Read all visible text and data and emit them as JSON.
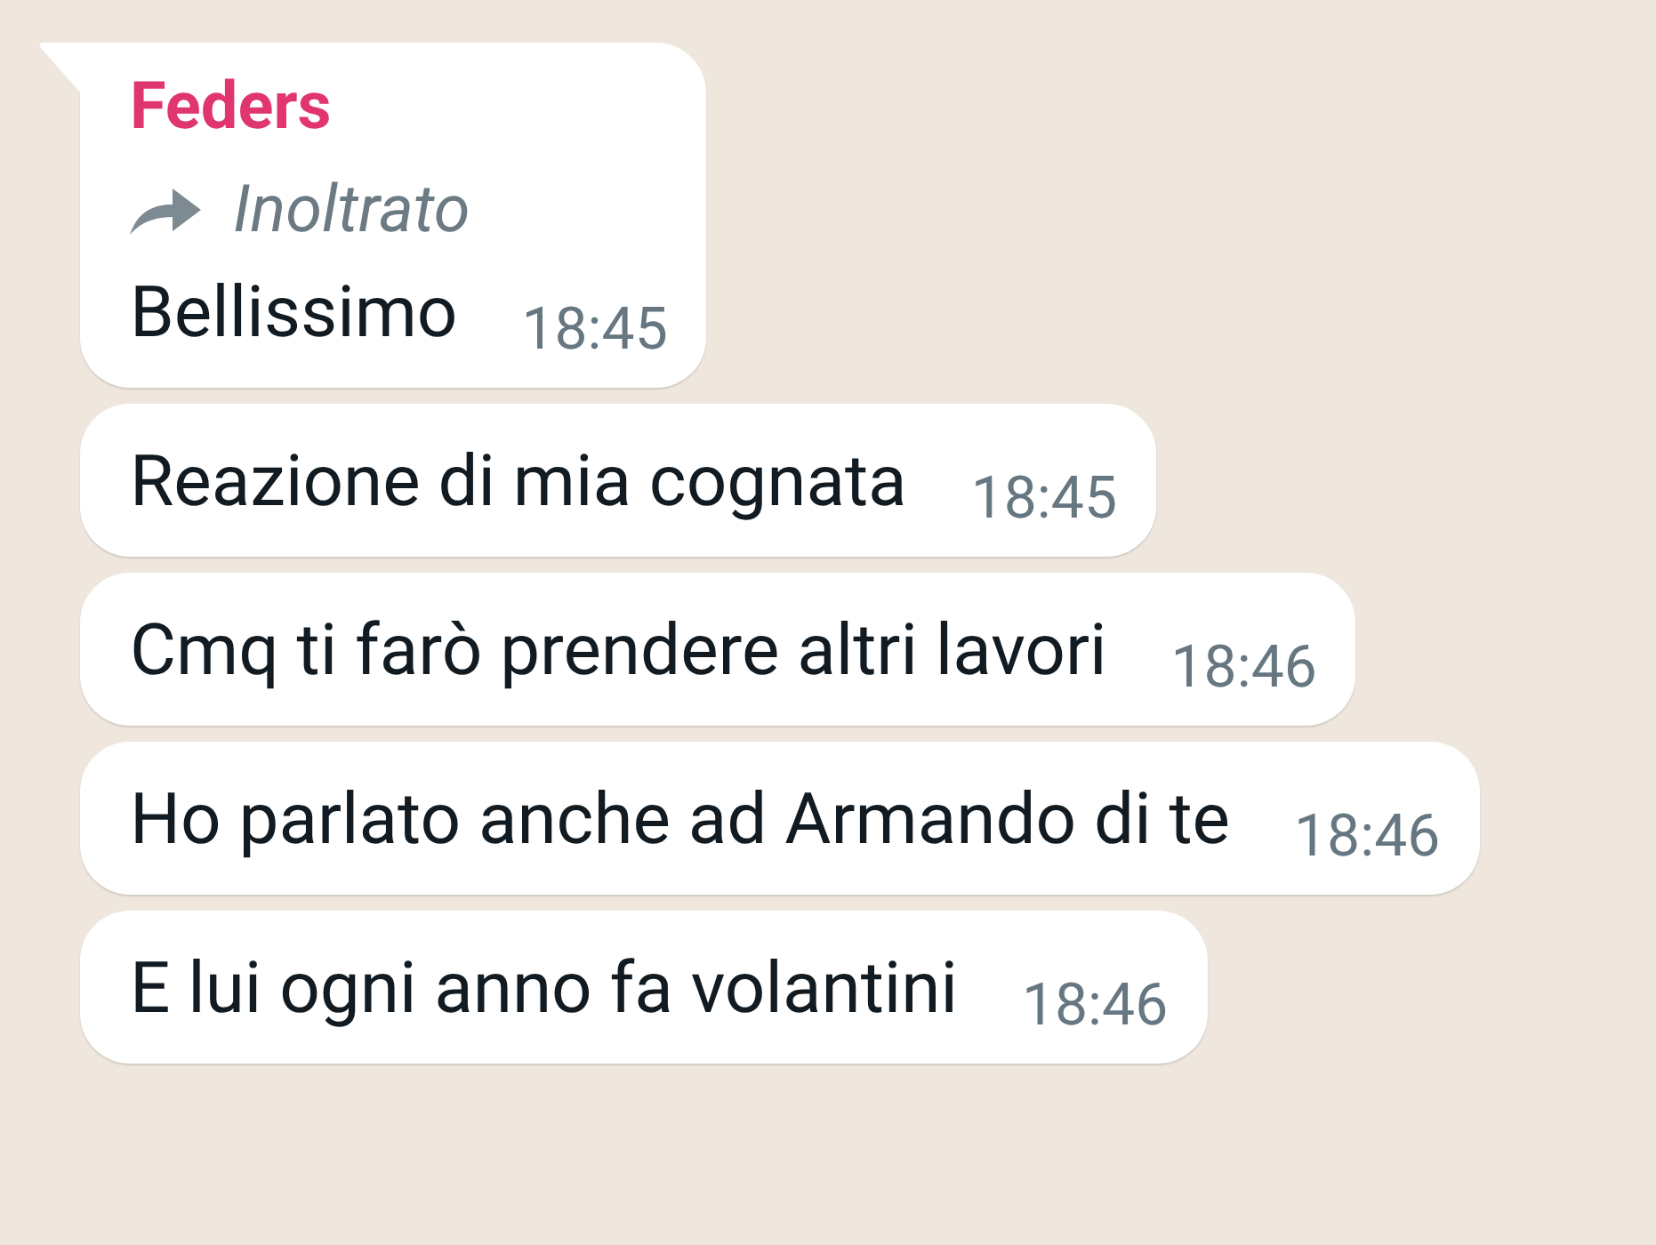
{
  "messages": [
    {
      "sender": "Feders",
      "color": "#e0356f",
      "forwarded": true,
      "forwarded_label": "Inoltrato",
      "text": "Bellissimo",
      "time": "18:45",
      "tail": true
    },
    {
      "text": "Reazione di mia cognata",
      "time": "18:45",
      "tail": false,
      "forwarded": false
    },
    {
      "text": "Cmq ti farò prendere altri lavori",
      "time": "18:46",
      "tail": false,
      "forwarded": false
    },
    {
      "text": "Ho parlato anche ad Armando di te",
      "time": "18:46",
      "tail": false,
      "forwarded": false
    },
    {
      "text": "E lui ogni anno fa volantini",
      "time": "18:46",
      "tail": false,
      "forwarded": false
    }
  ]
}
